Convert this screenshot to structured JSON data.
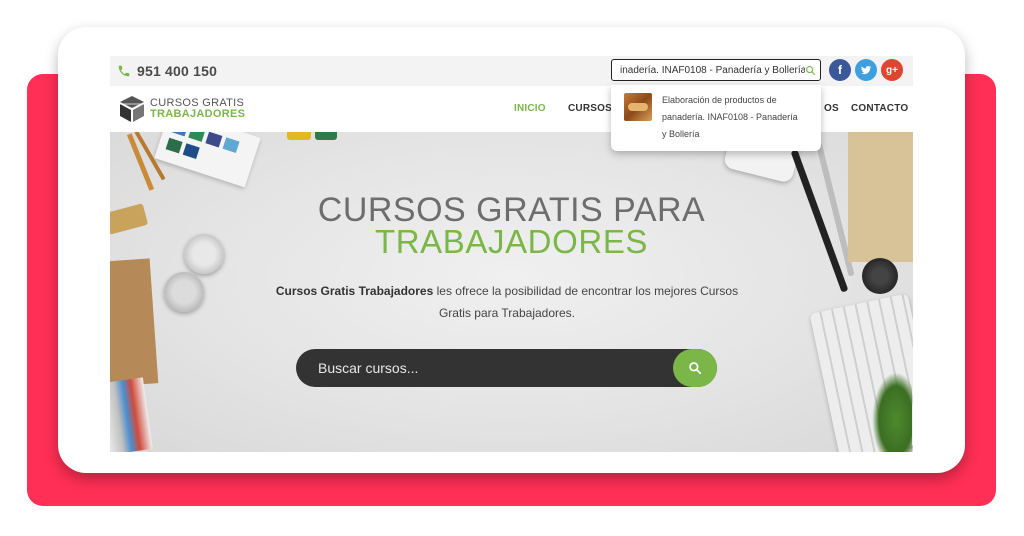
{
  "topbar": {
    "phone": "951 400 150",
    "search_value": "inadería. INAF0108 - Panadería y Bollería",
    "social": {
      "facebook": "f",
      "twitter": "t",
      "googleplus": "g+"
    }
  },
  "brand": {
    "line1": "CURSOS GRATIS",
    "line2": "TRABAJADORES"
  },
  "nav": {
    "items": [
      {
        "label": "INICIO"
      },
      {
        "label": "CURSOS"
      },
      {
        "label": "OS"
      },
      {
        "label": "CONTACTO"
      }
    ]
  },
  "autocomplete": {
    "items": [
      {
        "text_l1": "Elaboración de productos de",
        "text_l2": "panadería. INAF0108 - Panadería",
        "text_l3": "y Bollería"
      }
    ]
  },
  "hero": {
    "title_line1": "CURSOS GRATIS PARA",
    "title_line2": "TRABAJADORES",
    "desc_bold": "Cursos Gratis Trabajadores",
    "desc_rest": " les ofrece la posibilidad de encontrar los mejores Cursos Gratis para Trabajadores.",
    "search_placeholder": "Buscar cursos..."
  },
  "colors": {
    "accent": "#7ab648",
    "pink": "#ff2f55",
    "dark": "#333333"
  }
}
